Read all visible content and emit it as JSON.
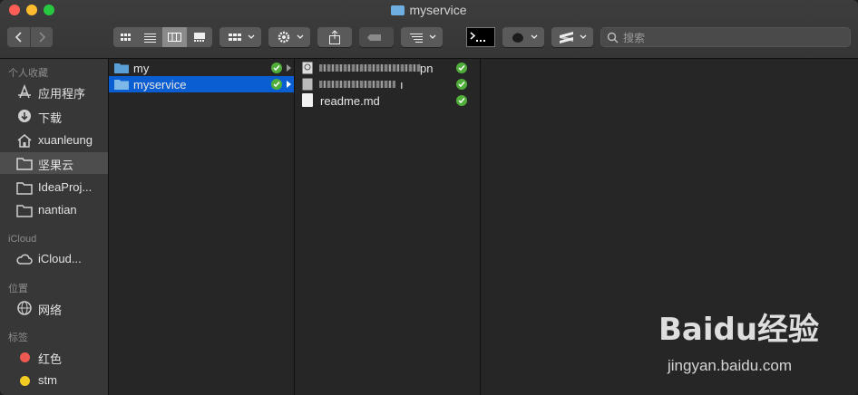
{
  "window": {
    "title": "myservice"
  },
  "toolbar": {
    "search_placeholder": "搜索"
  },
  "sidebar": {
    "sections": [
      {
        "title": "个人收藏",
        "items": [
          {
            "label": "应用程序",
            "icon": "applications-icon"
          },
          {
            "label": "下载",
            "icon": "download-icon"
          },
          {
            "label": "xuanleung",
            "icon": "home-icon"
          },
          {
            "label": "坚果云",
            "icon": "folder-icon",
            "selected": true
          },
          {
            "label": "IdeaProj...",
            "icon": "folder-icon"
          },
          {
            "label": "nantian",
            "icon": "folder-icon"
          }
        ]
      },
      {
        "title": "iCloud",
        "items": [
          {
            "label": "iCloud...",
            "icon": "cloud-icon"
          }
        ]
      },
      {
        "title": "位置",
        "items": [
          {
            "label": "网络",
            "icon": "network-icon"
          }
        ]
      },
      {
        "title": "标签",
        "items": [
          {
            "label": "红色",
            "color": "#ee5a52"
          },
          {
            "label": "stm",
            "color": "#f2cc23"
          }
        ]
      }
    ]
  },
  "column1": {
    "rows": [
      {
        "label": "my",
        "synced": true
      },
      {
        "label": "myservice",
        "synced": true,
        "selected": true
      }
    ]
  },
  "column2": {
    "rows": [
      {
        "label": "pn",
        "kind": "blurred",
        "synced": true
      },
      {
        "label": "ı",
        "kind": "blurred",
        "synced": true
      },
      {
        "label": "readme.md",
        "kind": "document",
        "synced": true
      }
    ]
  },
  "watermark": {
    "brand": "Baidu经验",
    "url": "jingyan.baidu.com"
  },
  "colors": {
    "selection": "#0b5ed1",
    "sync_green": "#4fae3a"
  }
}
